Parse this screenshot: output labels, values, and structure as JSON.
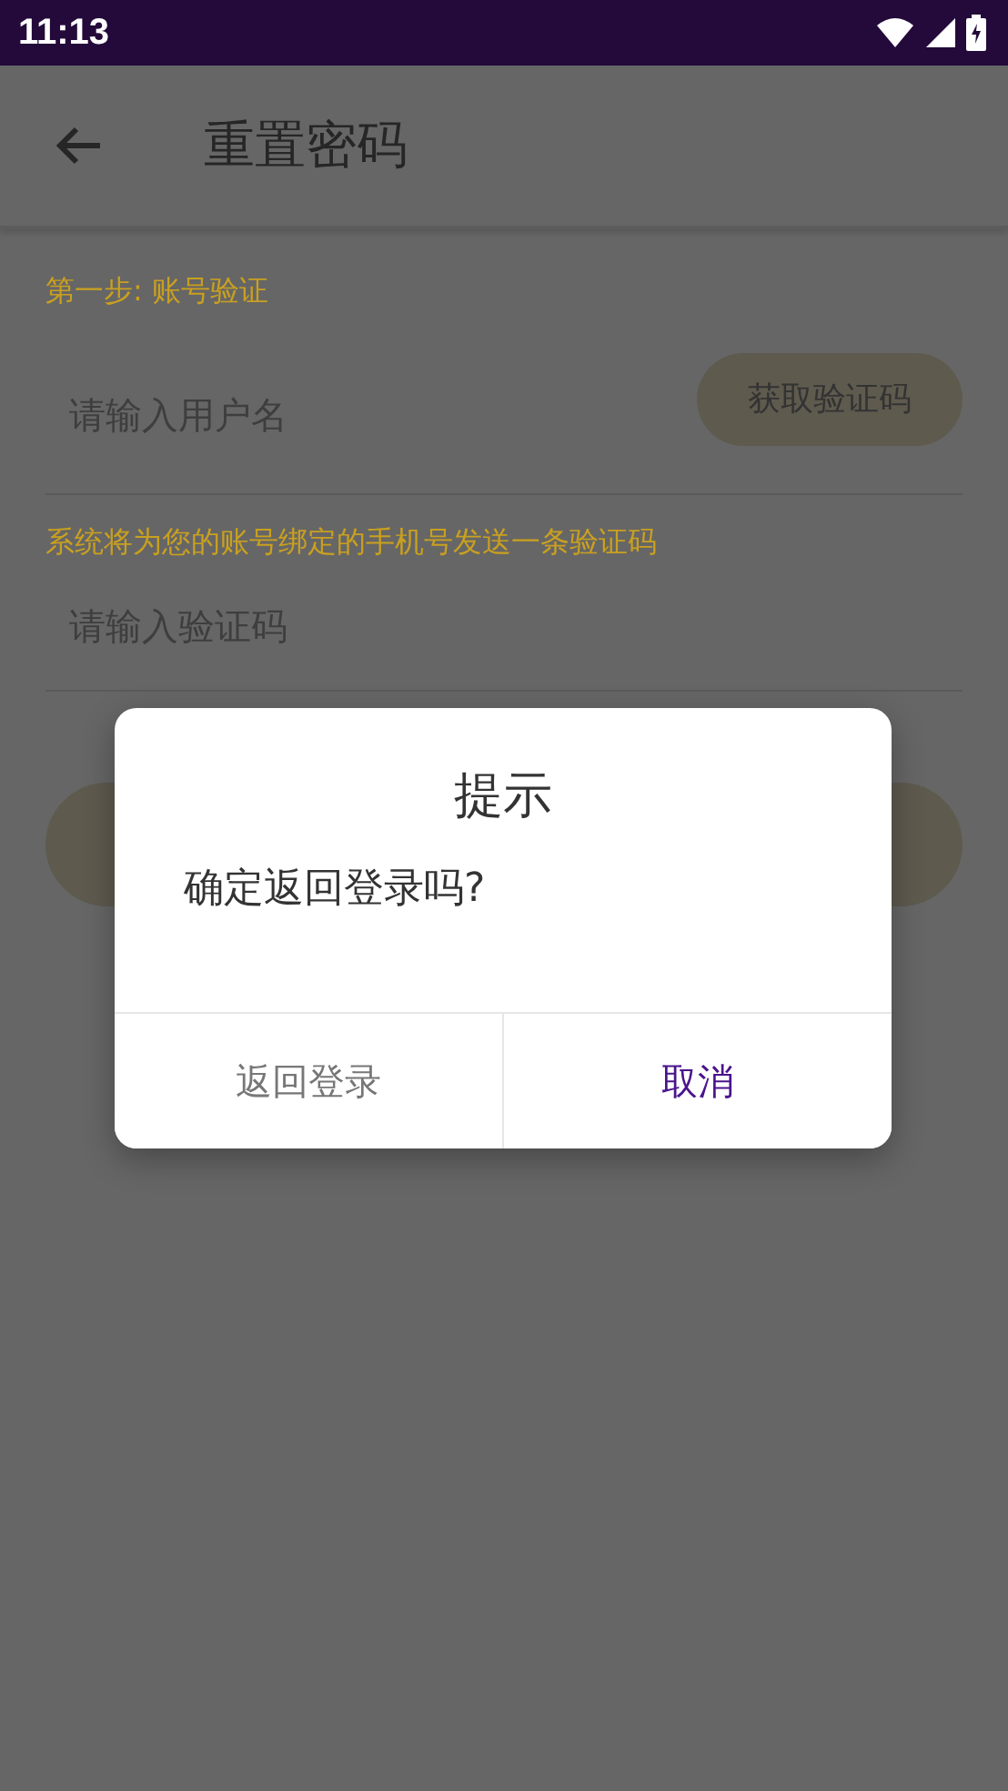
{
  "status_bar": {
    "time": "11:13"
  },
  "app_bar": {
    "title": "重置密码"
  },
  "step_label": "第一步: 账号验证",
  "username_field": {
    "placeholder": "请输入用户名"
  },
  "get_code_button": "获取验证码",
  "hint": "系统将为您的账号绑定的手机号发送一条验证码",
  "code_field": {
    "placeholder": "请输入验证码"
  },
  "dialog": {
    "title": "提示",
    "message": "确定返回登录吗?",
    "buttons": [
      {
        "label": "返回登录",
        "kind": "secondary"
      },
      {
        "label": "取消",
        "kind": "primary"
      }
    ]
  }
}
